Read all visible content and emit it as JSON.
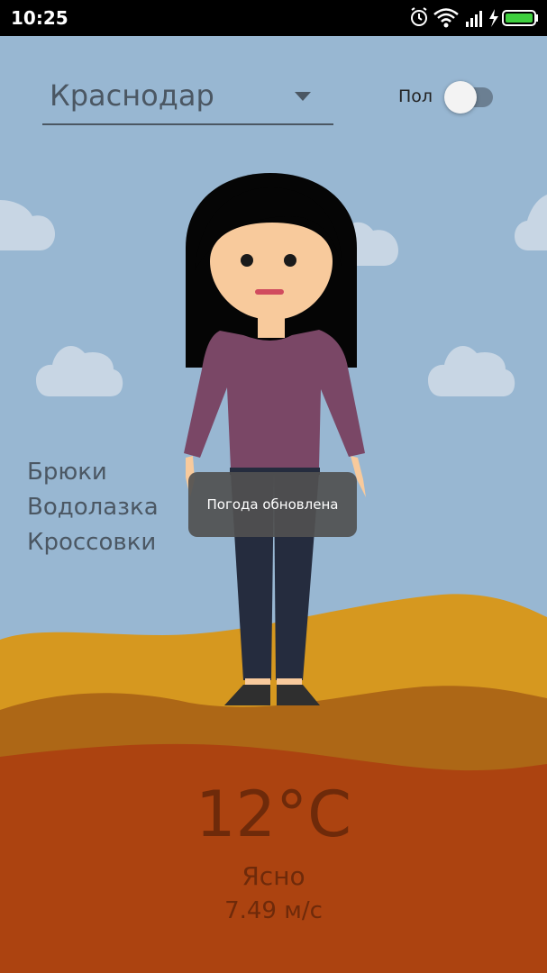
{
  "status_bar": {
    "time": "10:25",
    "icons": [
      "alarm-icon",
      "wifi-icon",
      "signal-icon",
      "charging-icon",
      "battery-icon"
    ]
  },
  "city_selector": {
    "value": "Краснодар",
    "icon": "dropdown-arrow-icon"
  },
  "gender_toggle": {
    "label": "Пол",
    "state": "off"
  },
  "clothing": [
    "Брюки",
    "Водолазка",
    "Кроссовки"
  ],
  "toast": {
    "message": "Погода обновлена"
  },
  "weather": {
    "temperature": "12°C",
    "condition": "Ясно",
    "wind": "7.49 м/с"
  },
  "colors": {
    "sky": "#98b7d2",
    "dune_light": "#d6981f",
    "dune_mid": "#ad6716",
    "ground": "#ac4310",
    "text_dark": "#4b5763",
    "weather_text": "#6e2a0a",
    "sweater": "#7a4766",
    "pants": "#252c3e",
    "hair": "#050505",
    "skin": "#f8ca9c"
  }
}
